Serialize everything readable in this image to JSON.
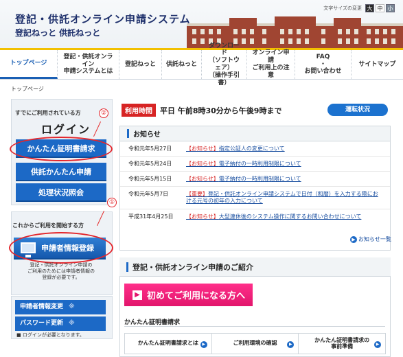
{
  "header": {
    "title": "登記・供託オンライン申請システム",
    "subtitle": "登記ねっと 供託ねっと",
    "font_size_label": "文字サイズの変更",
    "font_sizes": [
      "大",
      "中",
      "小"
    ]
  },
  "nav": {
    "items": [
      {
        "label": "トップページ"
      },
      {
        "label": "登記・供託オンライン\n申請システムとは"
      },
      {
        "label": "登記ねっと"
      },
      {
        "label": "供託ねっと"
      },
      {
        "label": "ダウンロード\n（ソフトウェア）\n（操作手引書）"
      },
      {
        "label": "オンライン申請\nご利用上の注意"
      },
      {
        "label": "FAQ\n・\nお問い合わせ"
      },
      {
        "label": "サイトマップ"
      }
    ]
  },
  "breadcrumb": "トップページ",
  "sidebar": {
    "already_label": "すでにご利用されている方",
    "login_title": "ログイン",
    "login_buttons": [
      "かんたん証明書請求",
      "供託かんたん申請",
      "処理状況照会"
    ],
    "new_user_title": "これからご利用を開始する方",
    "register_button": "申請者情報登録",
    "register_note": "登記・供託オンライン申請の\nご利用のためには申請者情報の\n登録が必要です。",
    "other_buttons": [
      {
        "label": "申請者情報変更",
        "mark": "※"
      },
      {
        "label": "パスワード更新",
        "mark": "※"
      }
    ],
    "login_required": "■ ログインが必要となります。",
    "annotations": [
      "①",
      "②"
    ]
  },
  "main": {
    "hours_label": "利用時間",
    "hours_text": "平日 午前8時30分から午後9時まで",
    "status_button": "運転状況",
    "notices_title": "お知らせ",
    "notices": [
      {
        "date": "令和元年5月27日",
        "tag": "【お知らせ】",
        "text": "指定公証人の変更について"
      },
      {
        "date": "令和元年5月24日",
        "tag": "【お知らせ】",
        "text": "電子納付の一時利用制限について"
      },
      {
        "date": "令和元年5月15日",
        "tag": "【お知らせ】",
        "text": "電子納付の一時利用制限について"
      },
      {
        "date": "令和元年5月7日",
        "tag": "【重要】",
        "text": "登記・供託オンライン申請システムで日付（和暦）を入力する際における元号の初年の入力について"
      },
      {
        "date": "平成31年4月25日",
        "tag": "【お知らせ】",
        "text": "大型連休後のシステム操作に関するお問い合わせについて"
      }
    ],
    "more_link": "お知らせ一覧",
    "intro_title": "登記・供託オンライン申請のご紹介",
    "first_time_button": "初めてご利用になる方へ",
    "cert_heading": "かんたん証明書請求",
    "cert_cells": [
      "かんたん証明書請求とは",
      "ご利用環境の確認",
      "かんたん証明書請求の\n事前準備"
    ]
  }
}
